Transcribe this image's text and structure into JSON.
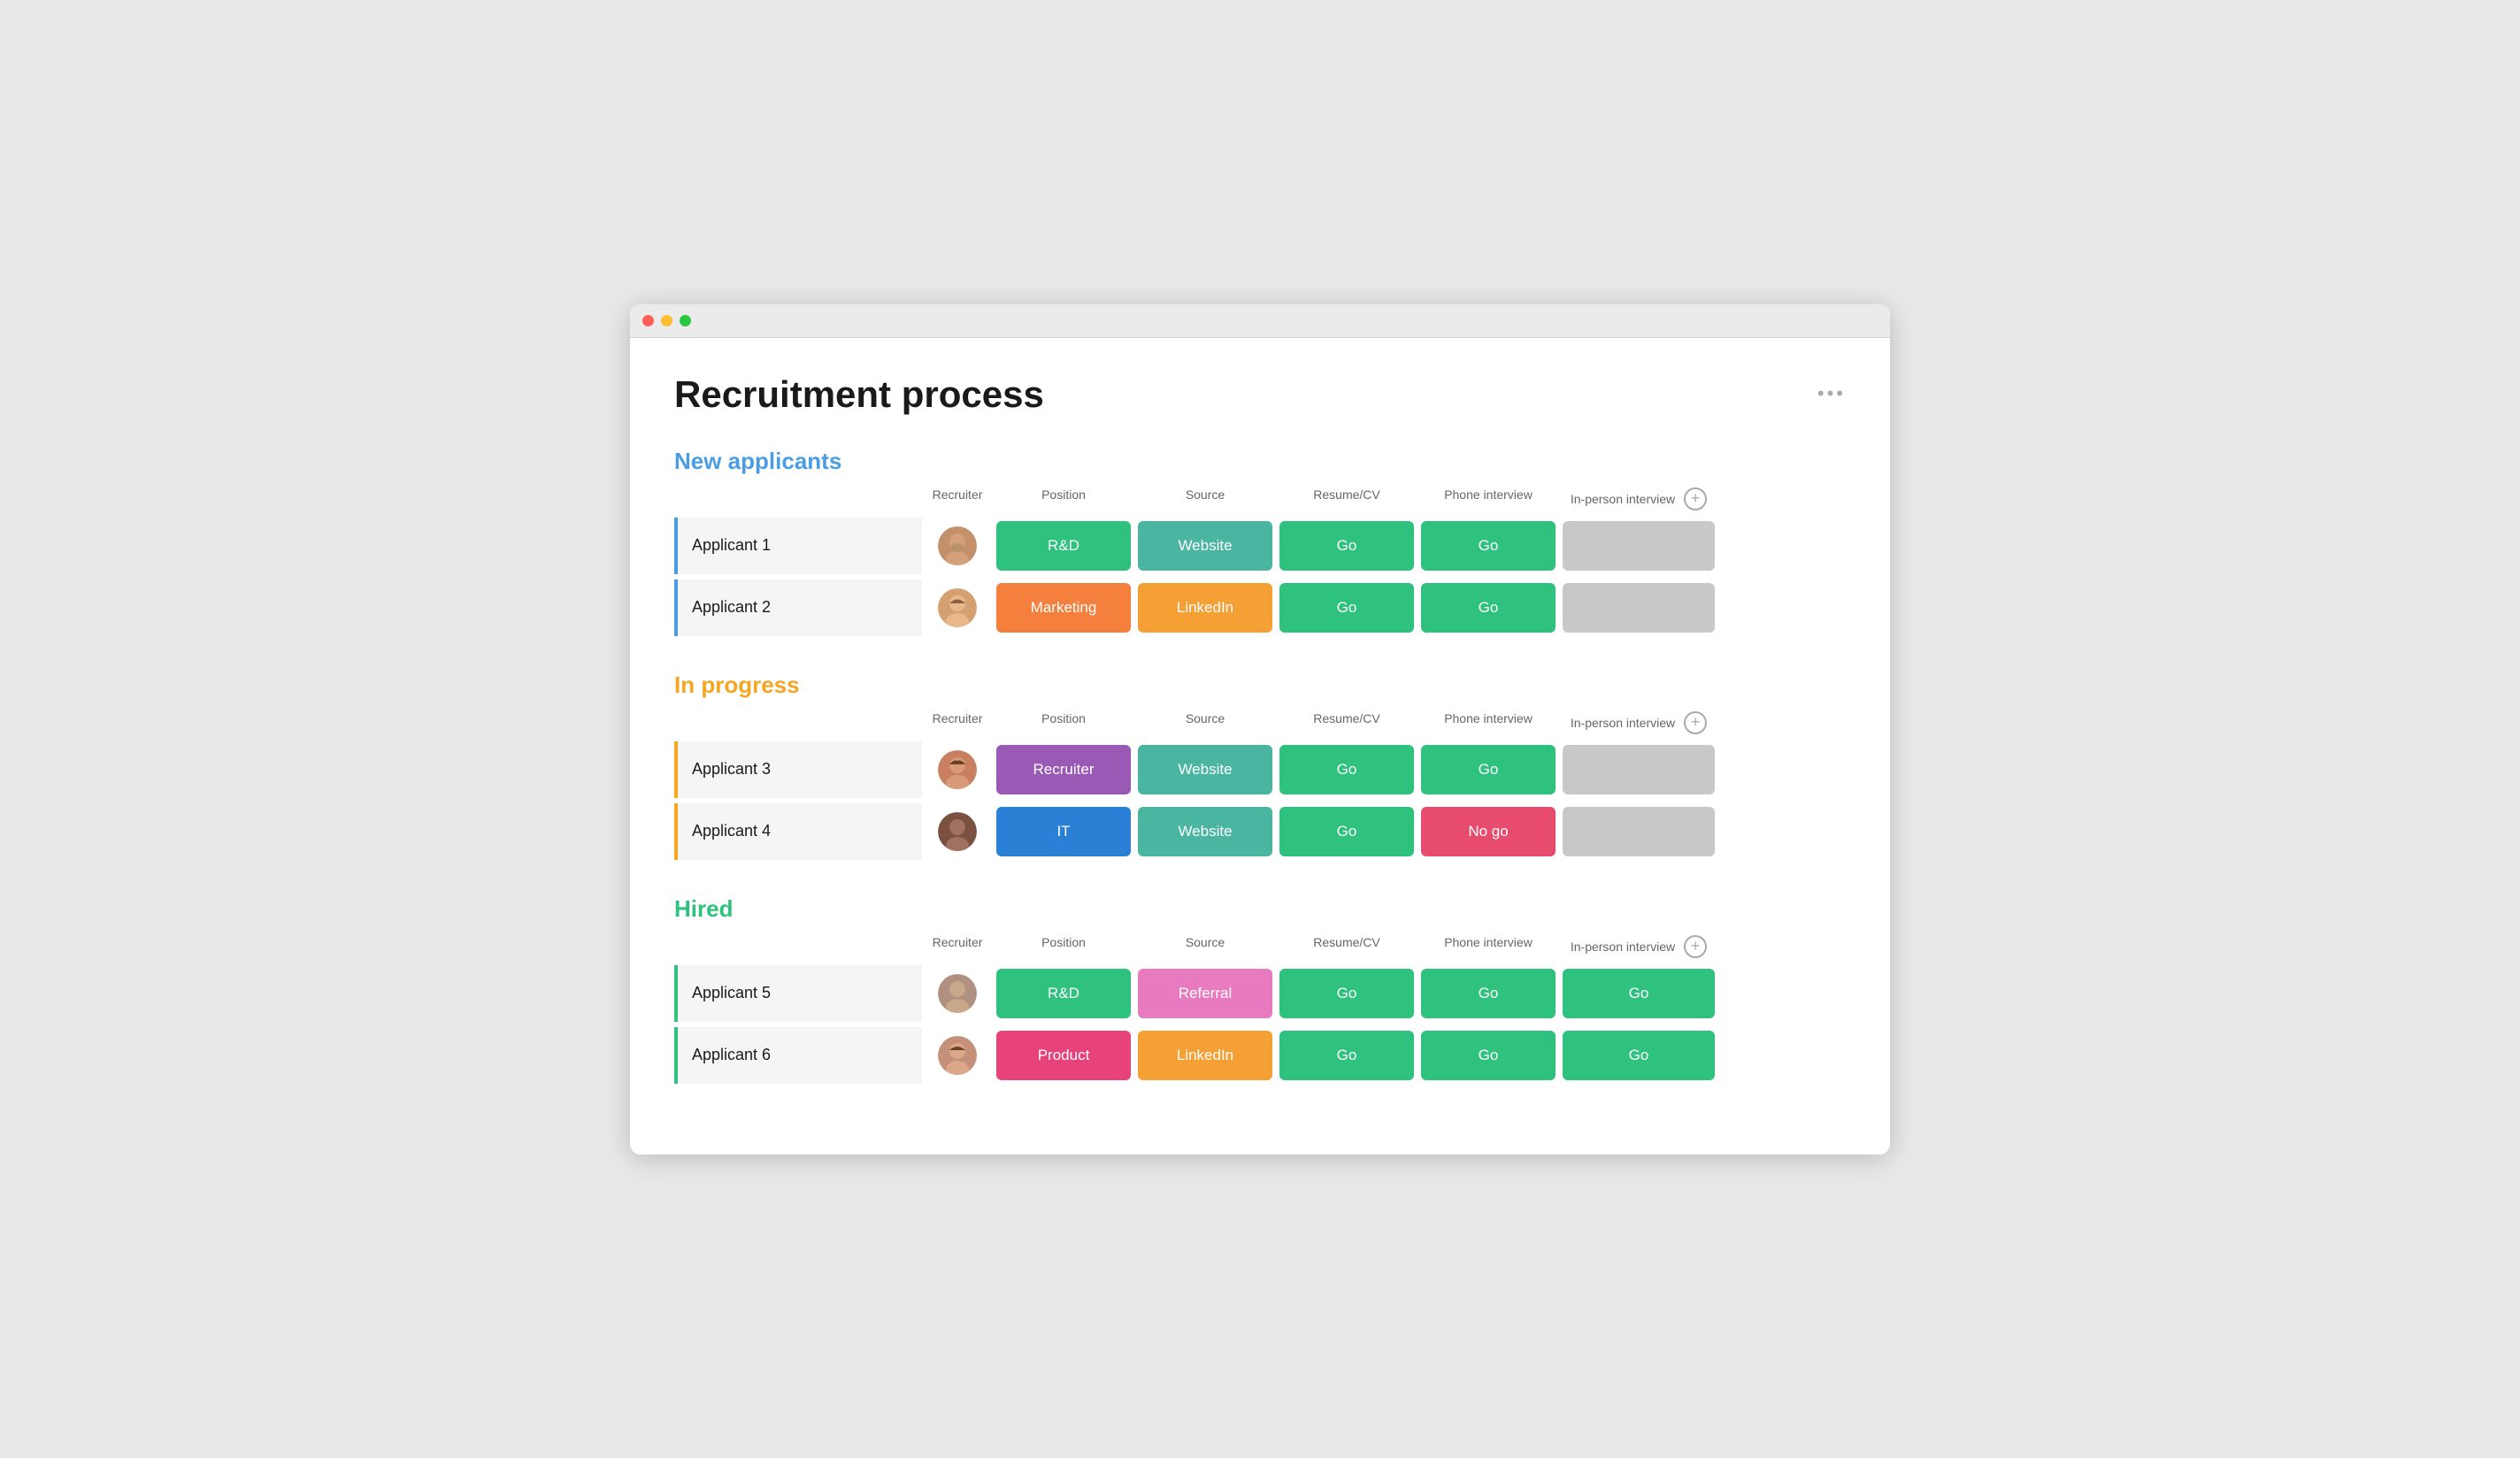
{
  "window": {
    "title": "Recruitment process"
  },
  "page": {
    "title": "Recruitment process",
    "more_icon": "•••"
  },
  "sections": [
    {
      "id": "new-applicants",
      "title": "New applicants",
      "color": "blue",
      "border_color": "border-blue",
      "headers": {
        "recruiter": "Recruiter",
        "position": "Position",
        "source": "Source",
        "resume": "Resume/CV",
        "phone": "Phone interview",
        "inperson": "In-person interview"
      },
      "rows": [
        {
          "name": "Applicant 1",
          "avatar_color": "#b08060",
          "avatar_emoji": "👨",
          "position": "R&D",
          "position_color": "green",
          "source": "Website",
          "source_color": "teal",
          "resume": "Go",
          "resume_color": "green",
          "phone": "Go",
          "phone_color": "green",
          "inperson": "",
          "inperson_color": "gray"
        },
        {
          "name": "Applicant 2",
          "avatar_color": "#d4956a",
          "avatar_emoji": "👩",
          "position": "Marketing",
          "position_color": "orange",
          "source": "LinkedIn",
          "source_color": "orange-light",
          "resume": "Go",
          "resume_color": "green",
          "phone": "Go",
          "phone_color": "green",
          "inperson": "",
          "inperson_color": "gray"
        }
      ]
    },
    {
      "id": "in-progress",
      "title": "In progress",
      "color": "orange",
      "border_color": "border-orange",
      "headers": {
        "recruiter": "Recruiter",
        "position": "Position",
        "source": "Source",
        "resume": "Resume/CV",
        "phone": "Phone interview",
        "inperson": "In-person interview"
      },
      "rows": [
        {
          "name": "Applicant 3",
          "avatar_color": "#c8956a",
          "avatar_emoji": "👩",
          "position": "Recruiter",
          "position_color": "purple",
          "source": "Website",
          "source_color": "teal",
          "resume": "Go",
          "resume_color": "green",
          "phone": "Go",
          "phone_color": "green",
          "inperson": "",
          "inperson_color": "gray"
        },
        {
          "name": "Applicant 4",
          "avatar_color": "#5a3a2a",
          "avatar_emoji": "👨",
          "position": "IT",
          "position_color": "blue",
          "source": "Website",
          "source_color": "teal",
          "resume": "Go",
          "resume_color": "green",
          "phone": "No go",
          "phone_color": "red",
          "inperson": "",
          "inperson_color": "gray"
        }
      ]
    },
    {
      "id": "hired",
      "title": "Hired",
      "color": "green",
      "border_color": "border-green",
      "headers": {
        "recruiter": "Recruiter",
        "position": "Position",
        "source": "Source",
        "resume": "Resume/CV",
        "phone": "Phone interview",
        "inperson": "In-person interview"
      },
      "rows": [
        {
          "name": "Applicant 5",
          "avatar_color": "#a08070",
          "avatar_emoji": "👨",
          "position": "R&D",
          "position_color": "green",
          "source": "Referral",
          "source_color": "pink-bright",
          "resume": "Go",
          "resume_color": "green",
          "phone": "Go",
          "phone_color": "green",
          "inperson": "Go",
          "inperson_color": "green"
        },
        {
          "name": "Applicant 6",
          "avatar_color": "#c09070",
          "avatar_emoji": "👩",
          "position": "Product",
          "position_color": "hot-pink",
          "source": "LinkedIn",
          "source_color": "orange-light",
          "resume": "Go",
          "resume_color": "green",
          "phone": "Go",
          "phone_color": "green",
          "inperson": "Go",
          "inperson_color": "green"
        }
      ]
    }
  ],
  "avatars": {
    "applicant1": {
      "bg": "#c4956a",
      "face": "😊"
    },
    "applicant2": {
      "bg": "#d4a070",
      "face": "🙂"
    },
    "applicant3": {
      "bg": "#c88060",
      "face": "😊"
    },
    "applicant4": {
      "bg": "#7a5040",
      "face": "🙂"
    },
    "applicant5": {
      "bg": "#b09080",
      "face": "😊"
    },
    "applicant6": {
      "bg": "#c4907a",
      "face": "🙂"
    }
  }
}
